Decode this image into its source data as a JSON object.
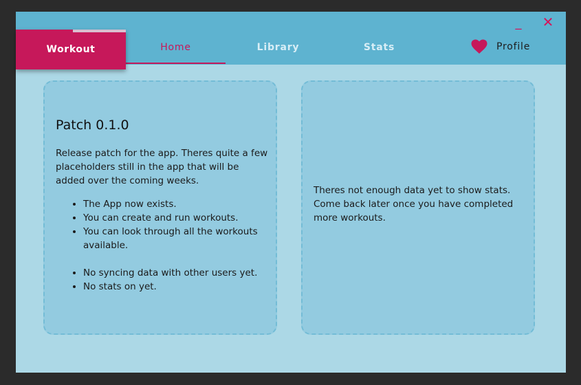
{
  "window": {
    "minimize_glyph": "_",
    "close_glyph": "✕"
  },
  "brand": {
    "label": "Workout",
    "progress": 0.48
  },
  "tabs": [
    {
      "label": "Home",
      "active": true
    },
    {
      "label": "Library",
      "active": false
    },
    {
      "label": "Stats",
      "active": false
    }
  ],
  "profile": {
    "label": "Profile",
    "icon": "heart-icon"
  },
  "patch_card": {
    "title": "Patch 0.1.0",
    "description": "Release patch for the app. Theres quite a few placeholders still in the app that will be added over the coming weeks.",
    "added": [
      "The App now exists.",
      "You can create and run workouts.",
      "You can look through all the workouts available."
    ],
    "pending": [
      "No syncing data with other users yet.",
      "No stats on yet."
    ]
  },
  "stats_card": {
    "message": "Theres not enough data yet to show stats. Come back later once you have completed more workouts."
  },
  "colors": {
    "accent": "#c6185a",
    "titlebar": "#5eb3d0",
    "background": "#acd8e6",
    "card": "#93cbe0"
  }
}
